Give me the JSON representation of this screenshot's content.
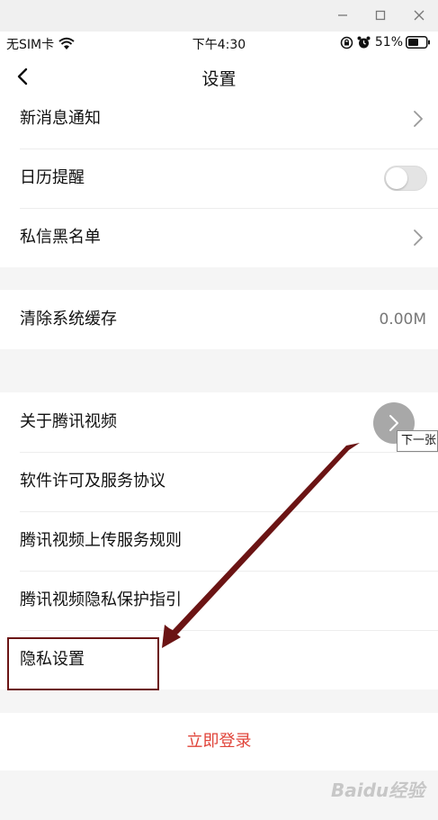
{
  "status_bar": {
    "carrier": "无SIM卡",
    "time": "下午4:30",
    "battery": "51%"
  },
  "nav": {
    "title": "设置",
    "back_icon": "chevron-left-icon"
  },
  "section1": {
    "items": [
      {
        "label": "新消息通知",
        "accessory": "chevron"
      },
      {
        "label": "日历提醒",
        "accessory": "toggle",
        "toggle_on": false
      },
      {
        "label": "私信黑名单",
        "accessory": "chevron"
      }
    ]
  },
  "section2": {
    "items": [
      {
        "label": "清除系统缓存",
        "value": "0.00M"
      }
    ]
  },
  "section3": {
    "items": [
      {
        "label": "关于腾讯视频"
      },
      {
        "label": "软件许可及服务协议"
      },
      {
        "label": "腾讯视频上传服务规则"
      },
      {
        "label": "腾讯视频隐私保护指引"
      },
      {
        "label": "隐私设置"
      }
    ]
  },
  "login": {
    "label": "立即登录"
  },
  "overlay": {
    "next_tooltip": "下一张",
    "watermark": "Baidu经验"
  },
  "colors": {
    "accent_red": "#e0443a",
    "annotation_red": "#6b1414",
    "page_bg": "#f5f5f5"
  }
}
